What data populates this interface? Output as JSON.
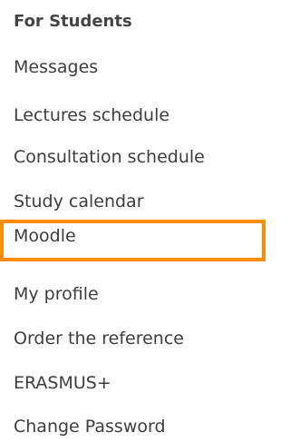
{
  "menu": {
    "heading": "For Students",
    "items": [
      {
        "label": "Messages"
      },
      {
        "label": "Lectures schedule"
      },
      {
        "label": "Consultation schedule"
      },
      {
        "label": "Study calendar"
      },
      {
        "label": "Moodle"
      },
      {
        "label": "My profile"
      },
      {
        "label": "Order the reference"
      },
      {
        "label": "ERASMUS+"
      },
      {
        "label": "Change Password"
      }
    ],
    "highlighted_item": "Moodle",
    "highlight_color": "#ff8c00"
  }
}
